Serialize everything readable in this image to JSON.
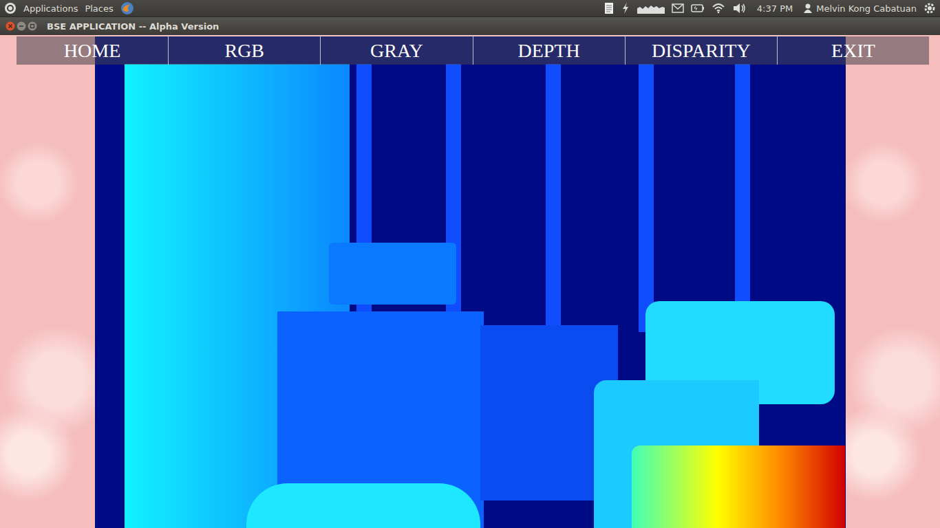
{
  "top_panel": {
    "menus": [
      "Applications",
      "Places"
    ],
    "clock": "4:37 PM",
    "user": "Melvin Kong Cabatuan"
  },
  "window": {
    "title": "BSE APPLICATION -- Alpha Version"
  },
  "nav": [
    {
      "label": "HOME"
    },
    {
      "label": "RGB"
    },
    {
      "label": "GRAY"
    },
    {
      "label": "DEPTH"
    },
    {
      "label": "DISPARITY"
    },
    {
      "label": "EXIT"
    }
  ]
}
